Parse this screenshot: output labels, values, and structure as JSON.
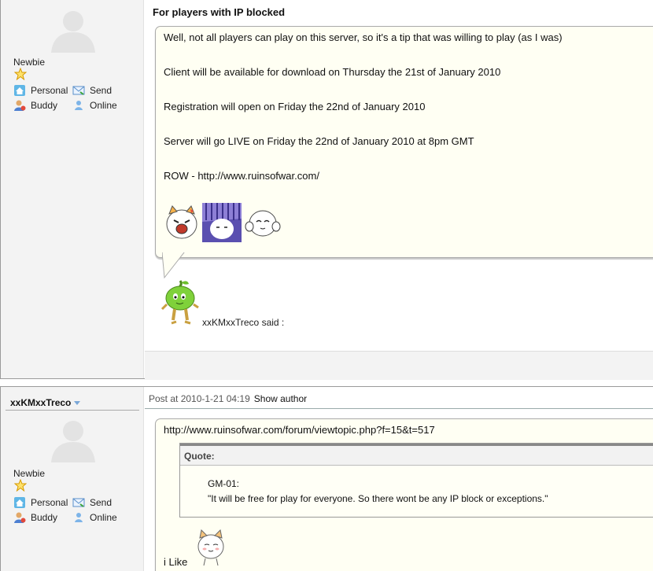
{
  "post1": {
    "user": {
      "rank": "Newbie",
      "actions": {
        "personal": "Personal",
        "send": "Send",
        "buddy": "Buddy",
        "online": "Online"
      }
    },
    "title": "For players with IP blocked",
    "lines": [
      "Well, not all players can play on this server, so it's a tip that was willing to play (as I was)",
      "Client will be available for download on Thursday the 21st of January 2010",
      "Registration will open on Friday the 22nd of January 2010",
      "Server will go LIVE on Friday the 22nd of January 2010 at 8pm GMT",
      "ROW - http://www.ruinsofwar.com/"
    ],
    "said_by": "xxKMxxTreco said :"
  },
  "post2": {
    "user": {
      "name": "xxKMxxTreco",
      "rank": "Newbie",
      "actions": {
        "personal": "Personal",
        "send": "Send",
        "buddy": "Buddy",
        "online": "Online"
      }
    },
    "post_at": "Post at 2010-1-21 04:19",
    "show_author": "Show author",
    "link": "http://www.ruinsofwar.com/forum/viewtopic.php?f=15&t=517",
    "quote": {
      "header": "Quote:",
      "author": "GM-01:",
      "text": "\"It will be free for play for everyone. So there wont be any IP block or exceptions.\""
    },
    "closing": "i Like"
  },
  "colors": {
    "bubble": "#fffff3",
    "sidebar": "#f3f3f3",
    "star": "#f5b400",
    "accent_green": "#6cbf2a"
  }
}
